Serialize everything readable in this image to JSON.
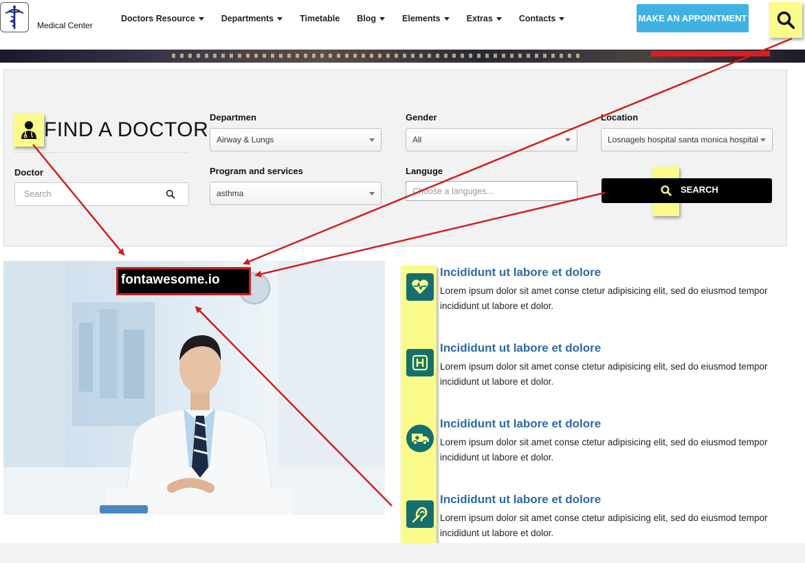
{
  "header": {
    "brand": "Medical Center",
    "nav": [
      {
        "label": "Doctors Resource",
        "dropdown": true
      },
      {
        "label": "Departments",
        "dropdown": true
      },
      {
        "label": "Timetable",
        "dropdown": false
      },
      {
        "label": "Blog",
        "dropdown": true
      },
      {
        "label": "Elements",
        "dropdown": true
      },
      {
        "label": "Extras",
        "dropdown": true
      },
      {
        "label": "Contacts",
        "dropdown": true
      }
    ],
    "appointment_label": "MAKE AN APPOINTMENT",
    "search_icon": "search-icon"
  },
  "find_doctor": {
    "title": "FIND A DOCTOR",
    "icon": "user-doctor-icon",
    "doctor_label": "Doctor",
    "doctor_placeholder": "Search",
    "department_label": "Departmen",
    "department_value": "Airway & Lungs",
    "program_label": "Program and services",
    "program_value": "asthma",
    "gender_label": "Gender",
    "gender_value": "All",
    "language_label": "Languge",
    "language_placeholder": "Choose a languges...",
    "location_label": "Location",
    "location_value": "Losnagels hospital santa monica hospital",
    "search_button": "SEARCH"
  },
  "annotation": {
    "callout": "fontawesome.io",
    "highlight_color": "#fbfb8c",
    "arrow_color": "#d41c1c"
  },
  "features": [
    {
      "icon": "heartbeat-icon",
      "title": "Incididunt ut labore et dolore",
      "line1": "Lorem ipsum dolor sit amet conse ctetur adipisicing elit, sed do eiusmod tempor",
      "line2": "incididunt ut labore et dolor."
    },
    {
      "icon": "hospital-icon",
      "title": "Incididunt ut labore et dolore",
      "line1": "Lorem ipsum dolor sit amet conse ctetur adipisicing elit, sed do eiusmod tempor",
      "line2": "incididunt ut labore et dolor."
    },
    {
      "icon": "ambulance-icon",
      "title": "Incididunt ut labore et dolore",
      "line1": "Lorem ipsum dolor sit amet conse ctetur adipisicing elit, sed do eiusmod tempor",
      "line2": "incididunt ut labore et dolor."
    },
    {
      "icon": "deaf-icon",
      "title": "Incididunt ut labore et dolore",
      "line1": "Lorem ipsum dolor sit amet conse ctetur adipisicing elit, sed do eiusmod tempor",
      "line2": "incididunt ut labore et dolor."
    }
  ],
  "colors": {
    "accent": "#3fb2e4",
    "feature_icon": "#156f6f",
    "feature_title": "#2c6aa6"
  }
}
